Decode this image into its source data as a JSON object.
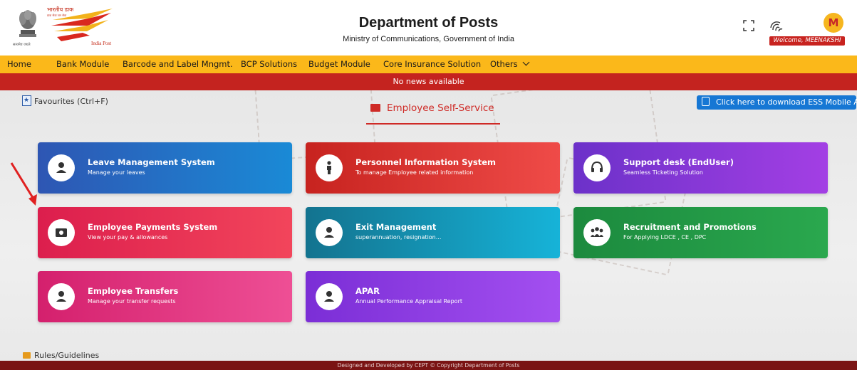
{
  "header": {
    "title": "Department of Posts",
    "subtitle": "Ministry of Communications, Government of India",
    "emblem_caption": "सत्यमेव जयते",
    "logo_hindi": "भारतीय डाक",
    "logo_tagline": "डाक सेवा जन सेवा",
    "logo_name": "India Post",
    "avatar_letter": "M",
    "welcome": "Welcome, MEENAKSHI"
  },
  "nav": {
    "items": [
      "Home",
      "Bank Module",
      "Barcode and Label Mngmt.",
      "BCP Solutions",
      "Budget Module",
      "Core Insurance Solution",
      "Others"
    ]
  },
  "news": "No news available",
  "main": {
    "favourites": "Favourites (Ctrl+F)",
    "ess_title": "Employee Self-Service",
    "download_app": "Click here to download ESS Mobile App",
    "cards": [
      {
        "title": "Leave Management System",
        "subtitle": "Manage your leaves",
        "icon": "person-icon"
      },
      {
        "title": "Personnel Information System",
        "subtitle": "To manage Employee related information",
        "icon": "person-standing-icon"
      },
      {
        "title": "Support desk (EndUser)",
        "subtitle": "Seamless Ticketing Solution",
        "icon": "headset-icon"
      },
      {
        "title": "Employee Payments System",
        "subtitle": "View your pay & allowances",
        "icon": "money-icon"
      },
      {
        "title": "Exit Management",
        "subtitle": "superannuation, resignation...",
        "icon": "person-icon"
      },
      {
        "title": "Recruitment and Promotions",
        "subtitle": "For Applying LDCE , CE , DPC",
        "icon": "group-icon"
      },
      {
        "title": "Employee Transfers",
        "subtitle": "Manage your transfer requests",
        "icon": "person-icon"
      },
      {
        "title": "APAR",
        "subtitle": "Annual Performance Appraisal Report",
        "icon": "person-icon"
      }
    ],
    "rules": "Rules/Guidelines"
  },
  "footer": "Designed and Developed by CEPT © Copyright Department of Posts",
  "colors": {
    "nav_bg": "#fbb81a",
    "news_bg": "#c4231f",
    "accent": "#cf2a26",
    "download_btn": "#1677d4",
    "footer_bg": "#7a1414"
  }
}
